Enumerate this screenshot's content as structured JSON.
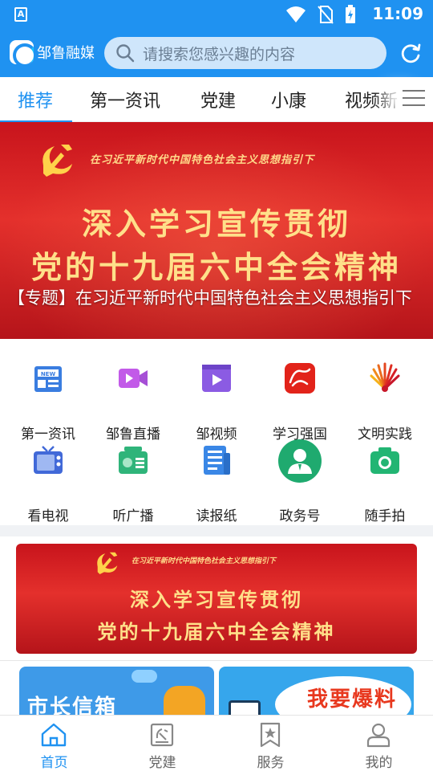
{
  "status_bar": {
    "time": "11:09",
    "app_indicator": "A",
    "icons": [
      "wifi-icon",
      "no-sim-icon",
      "battery-charging-icon"
    ]
  },
  "header": {
    "app_name": "邹鲁融媒",
    "search_placeholder": "请搜索您感兴趣的内容",
    "brand_color": "#1f92f1"
  },
  "tabs": [
    {
      "label": "推荐",
      "active": true
    },
    {
      "label": "第一资讯"
    },
    {
      "label": "党建"
    },
    {
      "label": "小康"
    },
    {
      "label": "视频新"
    }
  ],
  "banner": {
    "kicker": "在习近平新时代中国特色社会主义思想指引下",
    "line1": "深入学习宣传贯彻",
    "line2": "党的十九届六中全会精神",
    "caption": "【专题】在习近平新时代中国特色社会主义思想指引下"
  },
  "grid": [
    {
      "label": "第一资讯",
      "icon": "news-icon",
      "color": "#3a7de0"
    },
    {
      "label": "邹鲁直播",
      "icon": "video-camera-icon",
      "color": "#c25ae8"
    },
    {
      "label": "邹视频",
      "icon": "video-play-icon",
      "color": "#8b5be3"
    },
    {
      "label": "学习强国",
      "icon": "xuexi-qiangguo-icon",
      "color": "#e2231a"
    },
    {
      "label": "文明实践",
      "icon": "civilization-fan-icon",
      "color": "#e8501e"
    },
    {
      "label": "看电视",
      "icon": "tv-icon",
      "color": "#4169d8"
    },
    {
      "label": "听广播",
      "icon": "radio-icon",
      "color": "#2fb47a"
    },
    {
      "label": "读报纸",
      "icon": "newspaper-icon",
      "color": "#3a87e6"
    },
    {
      "label": "政务号",
      "icon": "official-account-icon",
      "color": "#1faa6f"
    },
    {
      "label": "随手拍",
      "icon": "camera-icon",
      "color": "#22b573"
    }
  ],
  "banner2": {
    "kicker": "在习近平新时代中国特色社会主义思想指引下",
    "line1": "深入学习宣传贯彻",
    "line2": "党的十九届六中全会精神"
  },
  "cards": [
    {
      "title": "市长信箱"
    },
    {
      "title": "我要爆料"
    }
  ],
  "bottom_nav": [
    {
      "label": "首页",
      "icon": "home-icon",
      "active": true
    },
    {
      "label": "党建",
      "icon": "party-building-icon"
    },
    {
      "label": "服务",
      "icon": "service-icon"
    },
    {
      "label": "我的",
      "icon": "profile-icon"
    }
  ]
}
